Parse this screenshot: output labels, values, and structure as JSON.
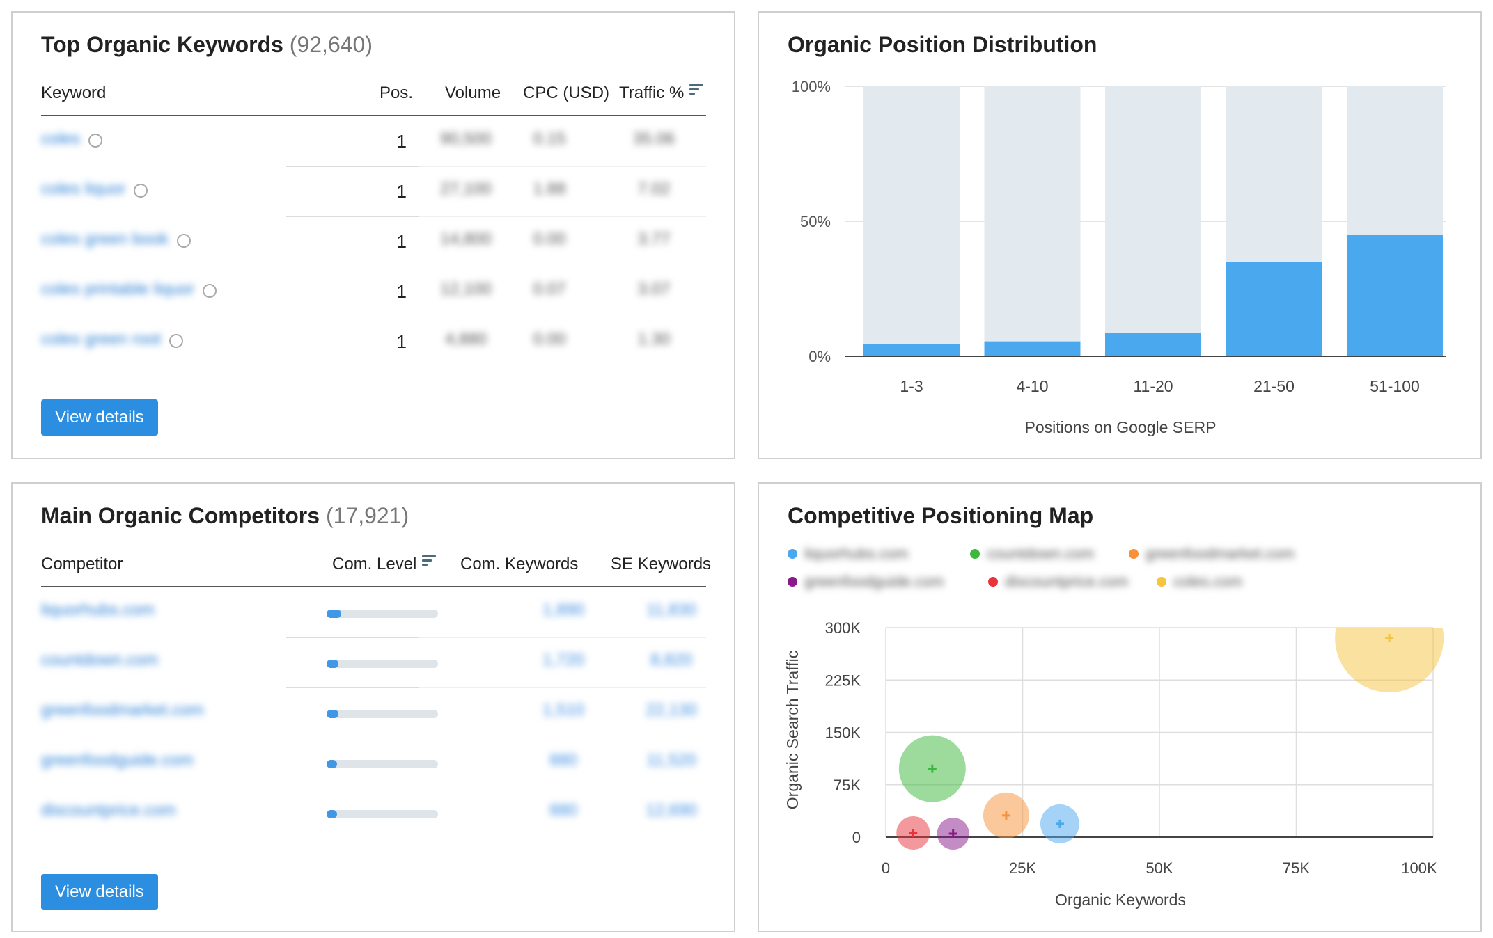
{
  "top_keywords": {
    "title": "Top Organic Keywords",
    "count": "(92,640)",
    "columns": {
      "keyword": "Keyword",
      "pos": "Pos.",
      "volume": "Volume",
      "cpc": "CPC (USD)",
      "traffic": "Traffic %"
    },
    "rows": [
      {
        "keyword": "coles",
        "pos": "1",
        "volume": "90,500",
        "cpc": "0.15",
        "traffic": "35.06"
      },
      {
        "keyword": "coles liquor",
        "pos": "1",
        "volume": "27,100",
        "cpc": "1.88",
        "traffic": "7.02"
      },
      {
        "keyword": "coles green book",
        "pos": "1",
        "volume": "14,800",
        "cpc": "0.00",
        "traffic": "3.77"
      },
      {
        "keyword": "coles printable liquor",
        "pos": "1",
        "volume": "12,100",
        "cpc": "0.07",
        "traffic": "3.07"
      },
      {
        "keyword": "coles green root",
        "pos": "1",
        "volume": "4,880",
        "cpc": "0.00",
        "traffic": "1.30"
      }
    ],
    "button": "View details"
  },
  "position_distribution": {
    "title": "Organic Position Distribution",
    "chart_data": {
      "type": "bar",
      "title": "Organic Position Distribution",
      "categories": [
        "1-3",
        "4-10",
        "11-20",
        "21-50",
        "51-100"
      ],
      "values": [
        4.5,
        5.5,
        8.5,
        35,
        45
      ],
      "ylim": [
        0,
        100
      ],
      "yticks": [
        "0%",
        "50%",
        "100%"
      ],
      "xlabel": "Positions on Google SERP",
      "colors": {
        "bar": "#4aa8ef",
        "track": "#e3eaef"
      }
    }
  },
  "competitors": {
    "title": "Main Organic Competitors",
    "count": "(17,921)",
    "columns": {
      "competitor": "Competitor",
      "level": "Com. Level",
      "com_keywords": "Com. Keywords",
      "se_keywords": "SE Keywords"
    },
    "rows": [
      {
        "domain": "liquorhubs.com",
        "level": 0.1,
        "com_keywords": "1,890",
        "se_keywords": "11,830"
      },
      {
        "domain": "countdown.com",
        "level": 0.08,
        "com_keywords": "1,720",
        "se_keywords": "8,820"
      },
      {
        "domain": "greenfoodmarket.com",
        "level": 0.08,
        "com_keywords": "1,510",
        "se_keywords": "22,130"
      },
      {
        "domain": "greenfoodguide.com",
        "level": 0.07,
        "com_keywords": "880",
        "se_keywords": "11,520"
      },
      {
        "domain": "discountprice.com",
        "level": 0.07,
        "com_keywords": "880",
        "se_keywords": "12,690"
      }
    ],
    "button": "View details"
  },
  "positioning_map": {
    "title": "Competitive Positioning Map",
    "legend": [
      {
        "label": "liquorhubs.com",
        "color": "#4aa8ef"
      },
      {
        "label": "countdown.com",
        "color": "#3cb83c"
      },
      {
        "label": "greenfoodmarket.com",
        "color": "#f7923a"
      },
      {
        "label": "greenfoodguide.com",
        "color": "#8a1a8a"
      },
      {
        "label": "discountprice.com",
        "color": "#e8323c"
      },
      {
        "label": "coles.com",
        "color": "#f7c440"
      }
    ],
    "chart_data": {
      "type": "scatter",
      "title": "Competitive Positioning Map",
      "xlabel": "Organic Keywords",
      "ylabel": "Organic Search Traffic",
      "xlim": [
        0,
        100000
      ],
      "ylim": [
        0,
        300000
      ],
      "xticks": [
        "0",
        "25K",
        "50K",
        "75K",
        "100K"
      ],
      "yticks": [
        "0",
        "75K",
        "150K",
        "225K",
        "300K"
      ],
      "series": [
        {
          "name": "liquorhubs.com",
          "x": 31800,
          "y": 19000,
          "r": 28,
          "color": "#4aa8ef"
        },
        {
          "name": "countdown.com",
          "x": 8500,
          "y": 98000,
          "r": 48,
          "color": "#3cb83c"
        },
        {
          "name": "greenfoodmarket.com",
          "x": 22000,
          "y": 31000,
          "r": 33,
          "color": "#f7923a"
        },
        {
          "name": "greenfoodguide.com",
          "x": 12300,
          "y": 5000,
          "r": 23,
          "color": "#8a1a8a"
        },
        {
          "name": "discountprice.com",
          "x": 5000,
          "y": 6000,
          "r": 24,
          "color": "#e8323c"
        },
        {
          "name": "coles.com",
          "x": 92000,
          "y": 285000,
          "r": 78,
          "color": "#f7c440"
        }
      ]
    }
  }
}
